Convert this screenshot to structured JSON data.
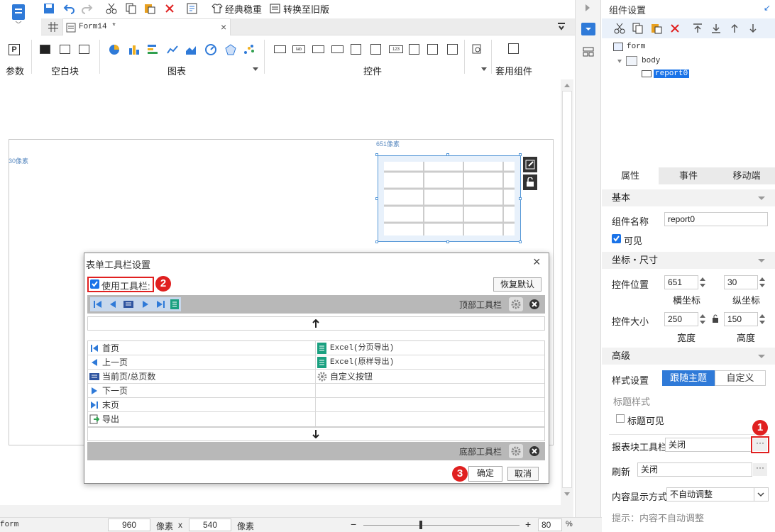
{
  "toolbar": {
    "classic": "经典稳重",
    "switch_old": "转换至旧版"
  },
  "tab": {
    "title": "Form14 *"
  },
  "ribbon": {
    "params": "参数",
    "blank": "空白块",
    "charts": "图表",
    "controls": "控件",
    "reuse": "套用组件"
  },
  "canvas": {
    "x_hint": "651像素",
    "y_hint": "30像素"
  },
  "panel": {
    "title": "组件设置",
    "tree": {
      "root": "form",
      "body": "body",
      "item": "report0"
    },
    "tabs": [
      "属性",
      "事件",
      "移动端"
    ],
    "basic": "基本",
    "name_label": "组件名称",
    "name_value": "report0",
    "visible": "可见",
    "coord_section": "坐标・尺寸",
    "pos_label": "控件位置",
    "pos_x": "651",
    "pos_y": "30",
    "x_caption": "横坐标",
    "y_caption": "纵坐标",
    "size_label": "控件大小",
    "width": "250",
    "height": "150",
    "w_caption": "宽度",
    "h_caption": "高度",
    "advanced": "高级",
    "style_label": "样式设置",
    "style_follow": "跟随主题",
    "style_custom": "自定义",
    "title_style": "标题样式",
    "title_visible": "标题可见",
    "toolbar_label": "报表块工具栏",
    "toolbar_value": "关闭",
    "refresh_label": "刷新",
    "refresh_value": "关闭",
    "content_label": "内容显示方式",
    "content_value": "不自动调整",
    "hint": "提示：内容不自动调整"
  },
  "dialog": {
    "title": "表单工具栏设置",
    "use_toolbar": "使用工具栏:",
    "restore": "恢复默认",
    "top_toolbar": "顶部工具栏",
    "bottom_toolbar": "底部工具栏",
    "left_items": [
      "首页",
      "上一页",
      "当前页/总页数",
      "下一页",
      "末页",
      "导出"
    ],
    "right_items": [
      "Excel(分页导出)",
      "Excel(原样导出)",
      "自定义按钮"
    ],
    "ok": "确定",
    "cancel": "取消"
  },
  "status": {
    "form": "form",
    "w": "960",
    "unit1": "像素",
    "x": "x",
    "h": "540",
    "unit2": "像素",
    "zoom": "80",
    "pct": "%"
  },
  "markers": [
    "1",
    "2",
    "3"
  ],
  "colors": {
    "accent": "#2f7ad8",
    "red": "#e02020",
    "select": "#1a73e8"
  }
}
